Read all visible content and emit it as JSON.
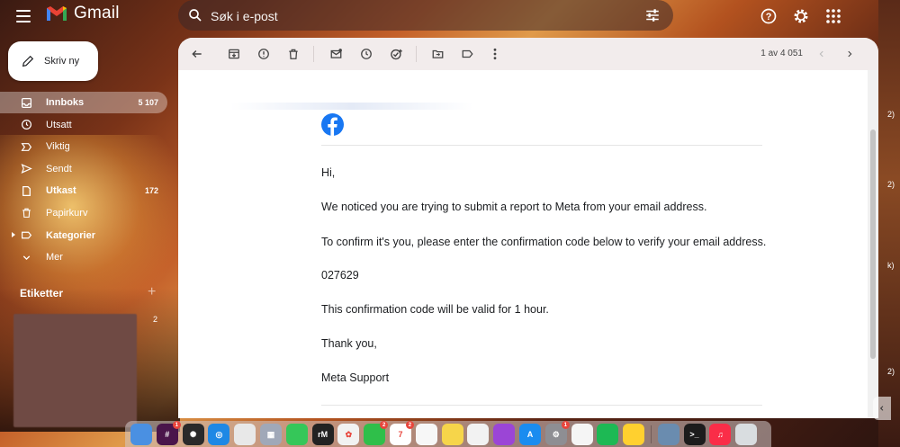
{
  "app": {
    "name": "Gmail"
  },
  "search": {
    "placeholder": "Søk i e-post"
  },
  "compose": {
    "label": "Skriv ny"
  },
  "nav": {
    "items": [
      {
        "label": "Innboks",
        "count": "5 107",
        "icon": "inbox-icon"
      },
      {
        "label": "Utsatt",
        "count": "",
        "icon": "clock-icon"
      },
      {
        "label": "Viktig",
        "count": "",
        "icon": "important-icon"
      },
      {
        "label": "Sendt",
        "count": "",
        "icon": "send-icon"
      },
      {
        "label": "Utkast",
        "count": "172",
        "icon": "draft-icon"
      },
      {
        "label": "Papirkurv",
        "count": "",
        "icon": "trash-icon"
      },
      {
        "label": "Kategorier",
        "count": "",
        "icon": "label-icon"
      },
      {
        "label": "Mer",
        "count": "",
        "icon": "chevron-down-icon"
      }
    ]
  },
  "labels": {
    "heading": "Etiketter",
    "count": "2"
  },
  "toolbar": {
    "pager": "1 av 4 051"
  },
  "email": {
    "greeting": "Hi,",
    "line1": "We noticed you are trying to submit a report to Meta from your email address.",
    "line2": "To confirm it's you, please enter the confirmation code below to verify your email address.",
    "code": "027629",
    "line3": "This confirmation code will be valid for 1 hour.",
    "thanks": "Thank you,",
    "signature": "Meta Support"
  },
  "dock": {
    "apps": [
      {
        "name": "finder-icon",
        "color": "#4a90e2",
        "text": ""
      },
      {
        "name": "slack-icon",
        "color": "#4a154b",
        "text": "#",
        "badge": "1"
      },
      {
        "name": "chatgpt-icon",
        "color": "#2a2a2a",
        "text": "✺"
      },
      {
        "name": "safari-icon",
        "color": "#1e88e5",
        "text": "◎"
      },
      {
        "name": "chrome-icon",
        "color": "#e8e8e8",
        "text": ""
      },
      {
        "name": "launchpad-icon",
        "color": "#a0a8b8",
        "text": "▦"
      },
      {
        "name": "messages-icon",
        "color": "#35c759",
        "text": ""
      },
      {
        "name": "readwise-icon",
        "color": "#222",
        "text": "rM"
      },
      {
        "name": "photos-icon",
        "color": "#f2f2f2",
        "text": "✿"
      },
      {
        "name": "facetime-icon",
        "color": "#2fbf4a",
        "text": "",
        "badge": "2"
      },
      {
        "name": "calendar-icon",
        "color": "#ffffff",
        "text": "7",
        "badge": "2"
      },
      {
        "name": "reminders-icon",
        "color": "#f7f7f7",
        "text": ""
      },
      {
        "name": "notes-icon",
        "color": "#f6d54a",
        "text": ""
      },
      {
        "name": "freeform-icon",
        "color": "#f2f2f2",
        "text": ""
      },
      {
        "name": "podcasts-icon",
        "color": "#9b45d6",
        "text": ""
      },
      {
        "name": "appstore-icon",
        "color": "#1a8cf0",
        "text": "A"
      },
      {
        "name": "settings-icon",
        "color": "#8e8e93",
        "text": "⚙",
        "badge": "1"
      },
      {
        "name": "drive-icon",
        "color": "#f5f5f5",
        "text": ""
      },
      {
        "name": "spotify-icon",
        "color": "#1db954",
        "text": ""
      },
      {
        "name": "miro-icon",
        "color": "#ffd02f",
        "text": ""
      },
      {
        "name": "screenshot-app-icon",
        "color": "#6a8caf",
        "text": ""
      },
      {
        "name": "terminal-icon",
        "color": "#1c1c1c",
        "text": ">_"
      },
      {
        "name": "music-icon",
        "color": "#fa2d48",
        "text": "♫"
      },
      {
        "name": "trash-dock-icon",
        "color": "#d9dde0",
        "text": ""
      }
    ]
  },
  "edge": {
    "t1": "2)",
    "t2": "2)",
    "t3": "k)",
    "t4": "2)"
  }
}
